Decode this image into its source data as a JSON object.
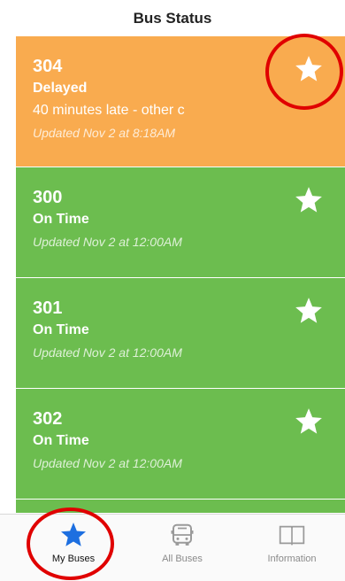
{
  "header": {
    "title": "Bus Status"
  },
  "colors": {
    "delayed": "#f9ab4f",
    "on_time": "#6cbd4f",
    "tab_active": "#1d6fe0",
    "tab_inactive": "#9a9a9a",
    "annotation": "#e00000"
  },
  "buses": [
    {
      "route": "304",
      "status": "Delayed",
      "detail": "40 minutes late - other c",
      "updated": "Updated Nov 2 at 8:18AM",
      "state": "delayed",
      "favorite_icon": "star-icon"
    },
    {
      "route": "300",
      "status": "On Time",
      "updated": "Updated Nov 2 at 12:00AM",
      "state": "on_time",
      "favorite_icon": "star-icon"
    },
    {
      "route": "301",
      "status": "On Time",
      "updated": "Updated Nov 2 at 12:00AM",
      "state": "on_time",
      "favorite_icon": "star-icon"
    },
    {
      "route": "302",
      "status": "On Time",
      "updated": "Updated Nov 2 at 12:00AM",
      "state": "on_time",
      "favorite_icon": "star-icon"
    }
  ],
  "tabs": [
    {
      "label": "My Buses",
      "icon": "star-icon",
      "active": true
    },
    {
      "label": "All Buses",
      "icon": "bus-icon",
      "active": false
    },
    {
      "label": "Information",
      "icon": "book-icon",
      "active": false
    }
  ]
}
